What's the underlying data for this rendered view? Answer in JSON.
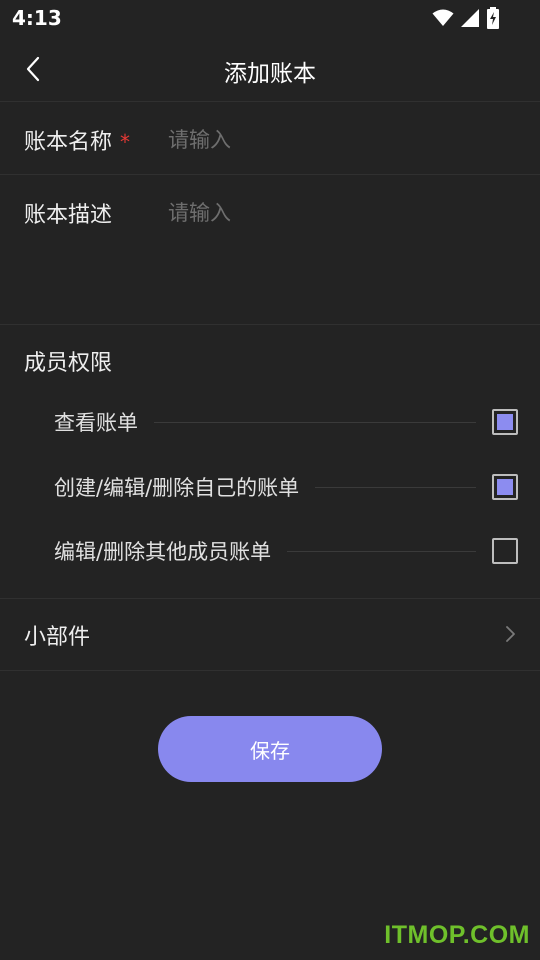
{
  "status_bar": {
    "time": "4:13",
    "icons": [
      "wifi-icon",
      "signal-icon",
      "battery-charging-icon"
    ]
  },
  "header": {
    "title": "添加账本",
    "back_icon": "chevron-left-icon"
  },
  "form": {
    "name_label": "账本名称",
    "required_mark": "*",
    "name_placeholder": "请输入",
    "name_value": "",
    "description_label": "账本描述",
    "description_placeholder": "请输入",
    "description_value": ""
  },
  "permissions": {
    "title": "成员权限",
    "items": [
      {
        "label": "查看账单",
        "checked": true
      },
      {
        "label": "创建/编辑/删除自己的账单",
        "checked": true
      },
      {
        "label": "编辑/删除其他成员账单",
        "checked": false
      }
    ]
  },
  "widget": {
    "label": "小部件",
    "icon": "chevron-right-icon"
  },
  "save_button": {
    "label": "保存"
  },
  "watermark": "ITMOP.COM",
  "colors": {
    "background": "#232323",
    "accent": "#8888ee",
    "checkbox_fill": "#8c8cf0",
    "required": "#e53935",
    "watermark": "#6fc02b"
  }
}
